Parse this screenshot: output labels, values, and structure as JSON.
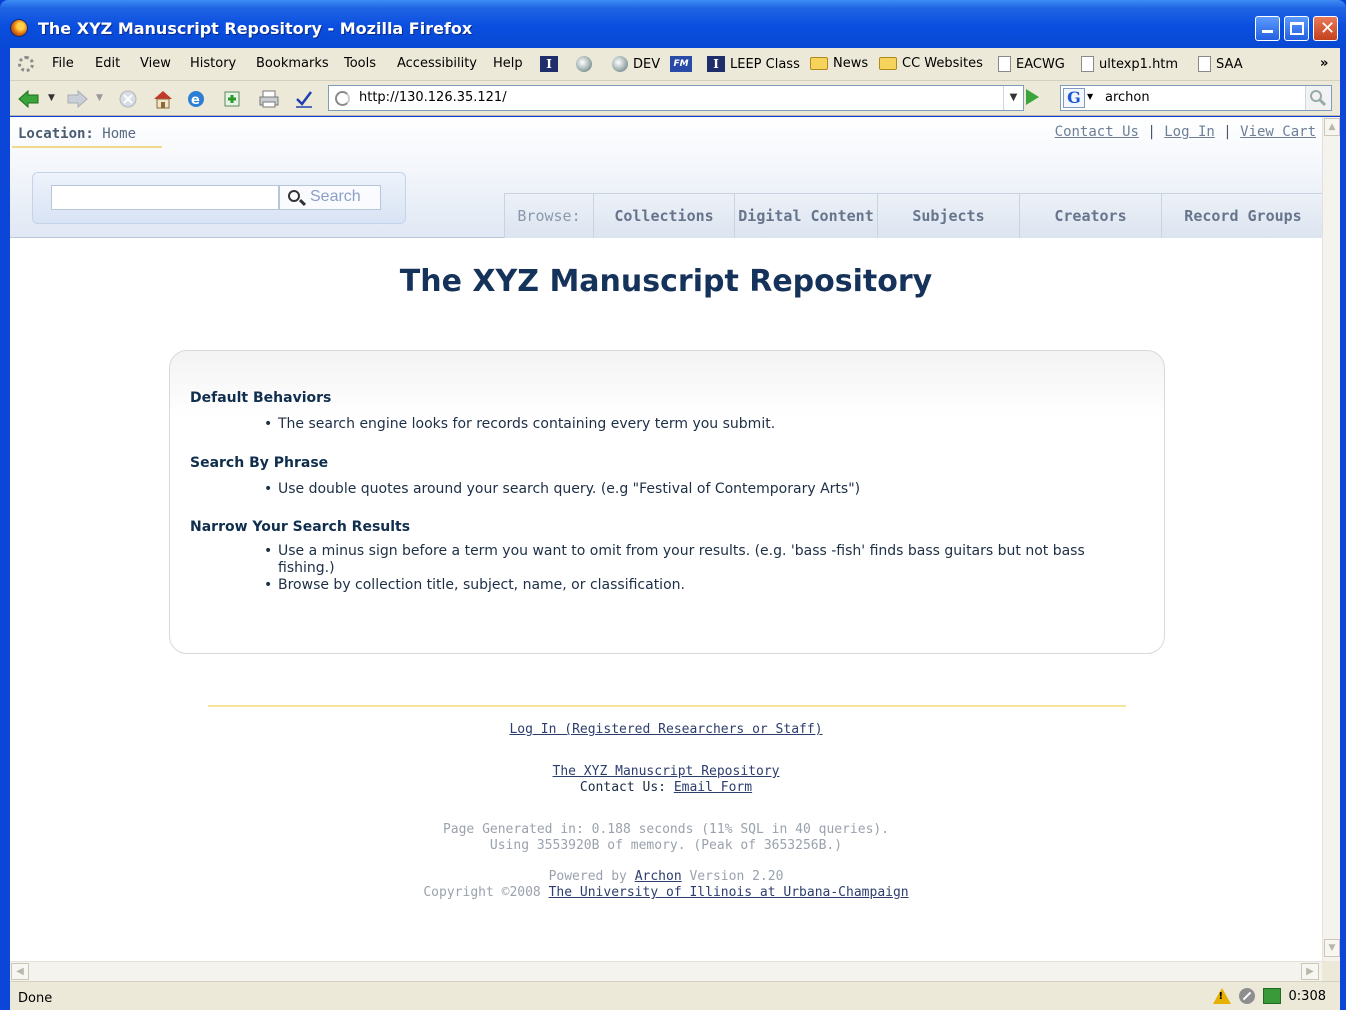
{
  "window": {
    "title": "The XYZ Manuscript Repository - Mozilla Firefox"
  },
  "menubar": {
    "items": [
      "File",
      "Edit",
      "View",
      "History",
      "Bookmarks",
      "Tools",
      "Accessibility",
      "Help"
    ],
    "bookmarks": [
      "DEV",
      "LEEP Class",
      "News",
      "CC Websites",
      "EACWG",
      "ultexp1.htm",
      "SAA"
    ],
    "overflow": "»"
  },
  "toolbar": {
    "url": "http://130.126.35.121/",
    "search_engine_icon": "G",
    "search_value": "archon"
  },
  "page": {
    "location_label": "Location:",
    "location_value": "Home",
    "toplinks": {
      "contact": "Contact Us",
      "login": "Log In",
      "cart": "View Cart",
      "sep": "|"
    },
    "search_button": "Search",
    "browse_label": "Browse:",
    "browse_tabs": [
      "Collections",
      "Digital Content",
      "Subjects",
      "Creators",
      "Record Groups"
    ],
    "title": "The XYZ Manuscript Repository",
    "help": {
      "sections": [
        {
          "heading": "Default Behaviors",
          "items": [
            "The search engine looks for records containing every term you submit."
          ]
        },
        {
          "heading": "Search By Phrase",
          "items": [
            "Use double quotes around your search query. (e.g \"Festival of Contemporary Arts\")"
          ]
        },
        {
          "heading": "Narrow Your Search Results",
          "items": [
            "Use a minus sign before a term you want to omit from your results. (e.g. 'bass -fish' finds bass guitars but not bass fishing.)",
            "Browse by collection title, subject, name, or classification."
          ]
        }
      ]
    },
    "footer": {
      "login_link": "Log In (Registered Researchers or Staff)",
      "repo_link": "The XYZ Manuscript Repository",
      "contact_label": "Contact Us:",
      "contact_link": "Email Form",
      "generated": "Page Generated in: 0.188 seconds (11% SQL in 40 queries).",
      "memory": "Using 3553920B of memory. (Peak of 3653256B.)",
      "powered_prefix": "Powered by",
      "powered_link": "Archon",
      "powered_suffix": "Version 2.20",
      "copyright_prefix": "Copyright ©2008",
      "copyright_link": "The University of Illinois at Urbana-Champaign"
    }
  },
  "statusbar": {
    "status": "Done",
    "timer": "0:308"
  }
}
